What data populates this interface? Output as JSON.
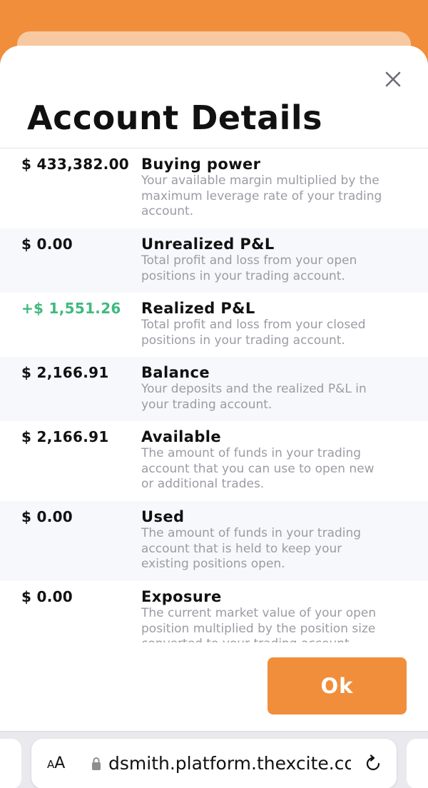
{
  "title": "Account Details",
  "rows": [
    {
      "amount": "$ 433,382.00",
      "label": "Buying power",
      "desc": [
        "Your available margin multiplied by the",
        "maximum leverage rate of your trading",
        "account."
      ]
    },
    {
      "amount": "$ 0.00",
      "label": "Unrealized P&L",
      "desc": [
        "Total profit and loss from your open",
        "positions in your trading account."
      ]
    },
    {
      "amount": "+$ 1,551.26",
      "label": "Realized P&L",
      "desc": [
        "Total profit and loss from your closed",
        "positions in your trading account."
      ]
    },
    {
      "amount": "$ 2,166.91",
      "label": "Balance",
      "desc": [
        "Your deposits and the realized P&L in",
        "your trading account."
      ]
    },
    {
      "amount": "$ 2,166.91",
      "label": "Available",
      "desc": [
        "The amount of funds in your trading",
        "account that you can use to open new",
        "or additional trades."
      ]
    },
    {
      "amount": "$ 0.00",
      "label": "Used",
      "desc": [
        "The amount of funds in your trading",
        "account that is held to keep your",
        "existing positions open."
      ]
    },
    {
      "amount": "$ 0.00",
      "label": "Exposure",
      "desc": [
        "The current market value of your open",
        "position multiplied by the position size",
        "converted to your trading account"
      ]
    }
  ],
  "ok_button": "Ok",
  "browser": {
    "aa_large": "A",
    "aa_small": "A",
    "url": "dsmith.platform.thexcite.com"
  },
  "colors": {
    "accent": "#f08e3c",
    "positive": "#3fba7e"
  }
}
